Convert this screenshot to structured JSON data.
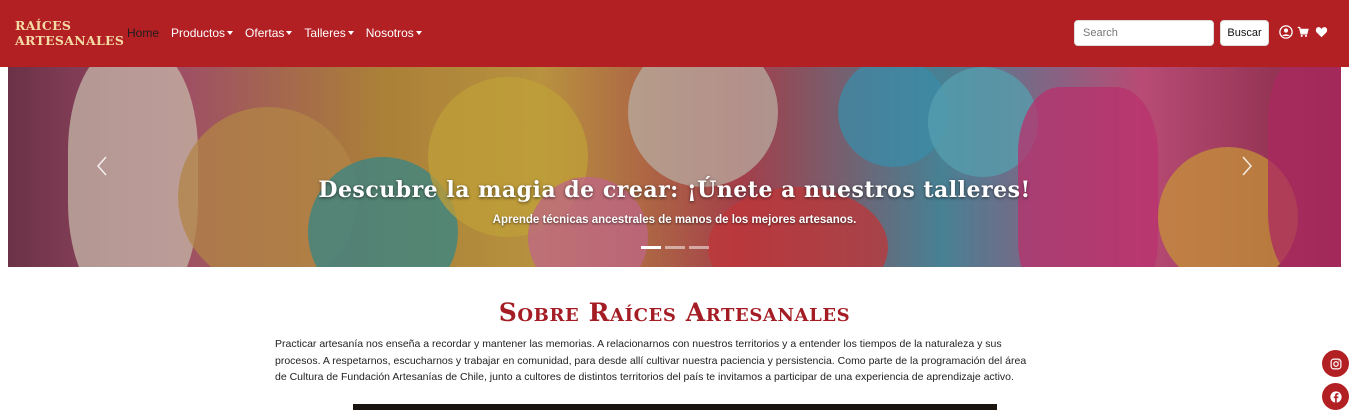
{
  "brand": {
    "line1": "RAÍCES",
    "line2": "ARTESANALES"
  },
  "nav": {
    "items": [
      {
        "label": "Home",
        "active": true,
        "dropdown": false
      },
      {
        "label": "Productos",
        "dropdown": true
      },
      {
        "label": "Ofertas",
        "dropdown": true
      },
      {
        "label": "Talleres",
        "dropdown": true
      },
      {
        "label": "Nosotros",
        "dropdown": true
      }
    ],
    "search_placeholder": "Search",
    "search_button": "Buscar",
    "icons": [
      "user-icon",
      "cart-icon",
      "heart-icon"
    ]
  },
  "hero": {
    "title": "Descubre la magia de crear: ¡Únete a nuestros talleres!",
    "subtitle": "Aprende técnicas ancestrales de manos de los mejores artesanos.",
    "slide_count": 3,
    "active_slide": 1
  },
  "about": {
    "title": "Sobre Raíces Artesanales",
    "lines": [
      "Practicar artesanía nos enseña a recordar y mantener las memorias. A relacionarnos con nuestros territorios y a entender los tiempos de la naturaleza y sus",
      "procesos. A respetarnos, escucharnos y trabajar en comunidad, para desde allí cultivar nuestra paciencia y persistencia. Como parte de la programación del área",
      "de Cultura de Fundación Artesanías de Chile, junto a cultores de distintos territorios del país te invitamos a participar de una experiencia de aprendizaje activo."
    ]
  },
  "social": [
    "instagram-icon",
    "facebook-icon"
  ],
  "colors": {
    "primary": "#b32024",
    "brand_text": "#f3d9a4",
    "title": "#a51d24"
  }
}
